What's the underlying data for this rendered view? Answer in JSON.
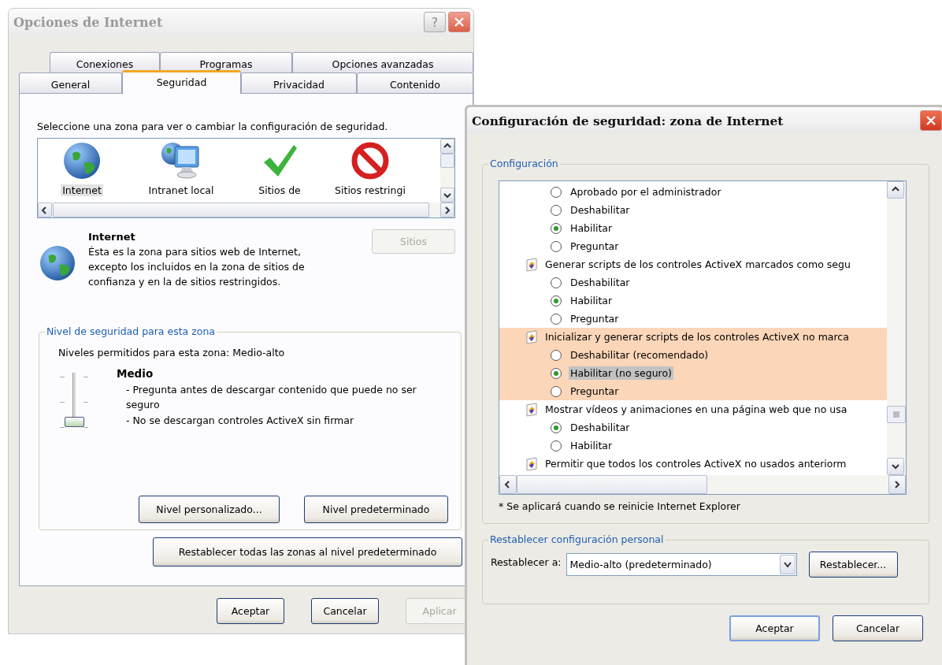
{
  "internet_options": {
    "title": "Opciones de Internet",
    "help_button": "?",
    "tab_rows": [
      [
        {
          "label": "Conexiones",
          "selected": false
        },
        {
          "label": "Programas",
          "selected": false
        },
        {
          "label": "Opciones avanzadas",
          "selected": false
        }
      ],
      [
        {
          "label": "General",
          "selected": false
        },
        {
          "label": "Seguridad",
          "selected": true
        },
        {
          "label": "Privacidad",
          "selected": false
        },
        {
          "label": "Contenido",
          "selected": false
        }
      ]
    ],
    "zone_prompt": "Seleccione una zona para ver o cambiar la configuración de seguridad.",
    "zones": [
      {
        "label": "Internet",
        "kind": "globe",
        "selected": true
      },
      {
        "label": "Intranet local",
        "kind": "intranet",
        "selected": false
      },
      {
        "label": "Sitios de",
        "kind": "trusted",
        "selected": false
      },
      {
        "label": "Sitios restringi",
        "kind": "restricted",
        "selected": false
      }
    ],
    "zone_info": {
      "name": "Internet",
      "description": "Ésta es la zona para sitios web de Internet, excepto los incluidos en la zona de sitios de confianza y en la de sitios restringidos.",
      "sites_button": {
        "label": "Sitios",
        "disabled": true
      }
    },
    "security_level": {
      "legend": "Nivel de seguridad para esta zona",
      "allowed": "Niveles permitidos para esta zona: Medio-alto",
      "slider": {
        "level": 0
      },
      "level_name": "Medio",
      "details": [
        "- Pregunta antes de descargar contenido que puede no ser seguro",
        "- No se descargan controles ActiveX sin firmar"
      ],
      "buttons": [
        {
          "label": "Nivel personalizado...",
          "disabled": false
        },
        {
          "label": "Nivel predeterminado",
          "disabled": false
        }
      ]
    },
    "reset_all_button": {
      "label": "Restablecer todas las zonas al nivel predeterminado",
      "disabled": false
    },
    "footer_buttons": [
      {
        "label": "Aceptar",
        "disabled": false
      },
      {
        "label": "Cancelar",
        "disabled": false
      },
      {
        "label": "Aplicar",
        "disabled": true
      }
    ]
  },
  "security_settings": {
    "title": "Configuración de seguridad: zona de Internet",
    "legend": "Configuración",
    "settings": [
      {
        "kind": "option",
        "label": "Aprobado por el administrador",
        "selected": false,
        "focused": false
      },
      {
        "kind": "option",
        "label": "Deshabilitar",
        "selected": false,
        "focused": false
      },
      {
        "kind": "option",
        "label": "Habilitar",
        "selected": true,
        "focused": false
      },
      {
        "kind": "option",
        "label": "Preguntar",
        "selected": false,
        "focused": false
      },
      {
        "kind": "setting",
        "label": "Generar scripts de los controles ActiveX marcados como segu",
        "highlighted": false,
        "children": [
          {
            "kind": "option",
            "label": "Deshabilitar",
            "selected": false,
            "focused": false
          },
          {
            "kind": "option",
            "label": "Habilitar",
            "selected": true,
            "focused": false
          },
          {
            "kind": "option",
            "label": "Preguntar",
            "selected": false,
            "focused": false
          }
        ]
      },
      {
        "kind": "setting",
        "label": "Inicializar y generar scripts de los controles ActiveX no marca",
        "highlighted": true,
        "children": [
          {
            "kind": "option",
            "label": "Deshabilitar (recomendado)",
            "selected": false,
            "focused": false
          },
          {
            "kind": "option",
            "label": "Habilitar (no seguro)",
            "selected": true,
            "focused": true
          },
          {
            "kind": "option",
            "label": "Preguntar",
            "selected": false,
            "focused": false
          }
        ]
      },
      {
        "kind": "setting",
        "label": "Mostrar vídeos y animaciones en una página web que no usa",
        "highlighted": false,
        "children": [
          {
            "kind": "option",
            "label": "Deshabilitar",
            "selected": true,
            "focused": false
          },
          {
            "kind": "option",
            "label": "Habilitar",
            "selected": false,
            "focused": false
          }
        ]
      },
      {
        "kind": "setting",
        "label": "Permitir que todos los controles ActiveX no usados anteriorm",
        "highlighted": false
      }
    ],
    "note": "* Se aplicará cuando se reinicie Internet Explorer",
    "reset": {
      "legend": "Restablecer configuración personal",
      "label": "Restablecer a:",
      "value": "Medio-alto (predeterminado)",
      "button": "Restablecer..."
    },
    "buttons": [
      {
        "label": "Aceptar",
        "default": true
      },
      {
        "label": "Cancelar",
        "default": false
      }
    ]
  }
}
